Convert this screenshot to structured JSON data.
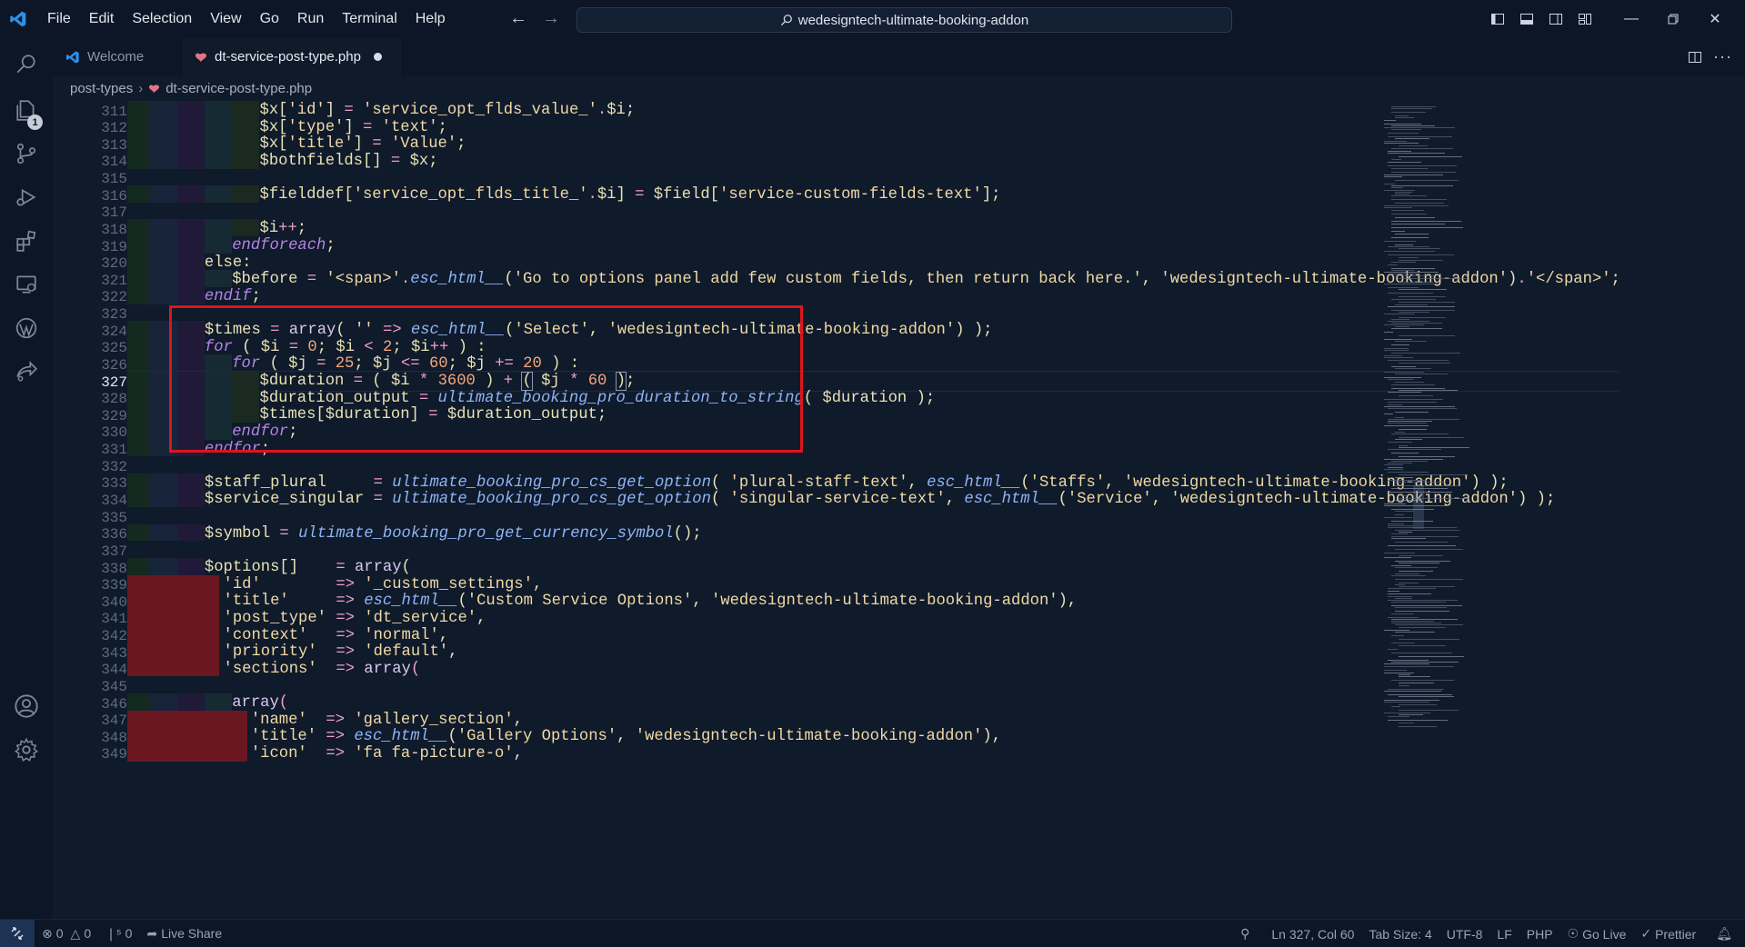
{
  "menu": [
    "File",
    "Edit",
    "Selection",
    "View",
    "Go",
    "Run",
    "Terminal",
    "Help"
  ],
  "search": {
    "text": "wedesigntech-ultimate-booking-addon"
  },
  "activity": {
    "scm_badge": "1"
  },
  "tabs": [
    {
      "label": "Welcome",
      "active": false
    },
    {
      "label": "dt-service-post-type.php",
      "active": true,
      "dirty": true
    }
  ],
  "breadcrumb": {
    "folder": "post-types",
    "file": "dt-service-post-type.php"
  },
  "editor": {
    "first_visible_line": "310",
    "current_line": 327,
    "lines": [
      {
        "n": "311",
        "indent": 5,
        "html": "<span class='v'>$x</span><span class='p'>[</span><span class='s'>'id'</span><span class='p'>] </span><span class='o'>=</span> <span class='s'>'service_opt_flds_value_'</span><span class='o'>.</span><span class='v'>$i</span><span class='p'>;</span>"
      },
      {
        "n": "312",
        "indent": 5,
        "html": "<span class='v'>$x</span><span class='p'>[</span><span class='s'>'type'</span><span class='p'>] </span><span class='o'>=</span> <span class='s'>'text'</span><span class='p'>;</span>"
      },
      {
        "n": "313",
        "indent": 5,
        "html": "<span class='v'>$x</span><span class='p'>[</span><span class='s'>'title'</span><span class='p'>] </span><span class='o'>=</span> <span class='s'>'Value'</span><span class='p'>;</span>"
      },
      {
        "n": "314",
        "indent": 5,
        "html": "<span class='v'>$bothfields</span><span class='p'>[] </span><span class='o'>=</span> <span class='v'>$x</span><span class='p'>;</span>"
      },
      {
        "n": "315",
        "indent": 0,
        "html": ""
      },
      {
        "n": "316",
        "indent": 5,
        "html": "<span class='v'>$fielddef</span><span class='p'>[</span><span class='s'>'service_opt_flds_title_'</span><span class='o'>.</span><span class='v'>$i</span><span class='p'>] </span><span class='o'>=</span> <span class='v'>$field</span><span class='p'>[</span><span class='s'>'service-custom-fields-text'</span><span class='p'>];</span>"
      },
      {
        "n": "317",
        "indent": 0,
        "html": ""
      },
      {
        "n": "318",
        "indent": 5,
        "html": "<span class='v'>$i</span><span class='o'>++</span><span class='p'>;</span>"
      },
      {
        "n": "319",
        "indent": 4,
        "html": "<span class='k'>endforeach</span><span class='p'>;</span>"
      },
      {
        "n": "320",
        "indent": 3,
        "html": "<span class='k' style='font-style:normal;color:#e8e2b4'>else</span><span class='p'>:</span>"
      },
      {
        "n": "321",
        "indent": 4,
        "html": "<span class='v'>$before</span> <span class='o'>=</span> <span class='s'>'&lt;span&gt;'</span><span class='o'>.</span><span class='f'>esc_html__</span><span class='p'>(</span><span class='s'>'Go to options panel add few custom fields, then return back here.'</span><span class='p'>, </span><span class='s'>'wedesigntech-ultimate-booking-addon'</span><span class='p'>)</span><span class='o'>.</span><span class='s'>'&lt;/span&gt;'</span><span class='p'>;</span>"
      },
      {
        "n": "322",
        "indent": 3,
        "html": "<span class='k'>endif</span><span class='p'>;</span>"
      },
      {
        "n": "323",
        "indent": 0,
        "html": ""
      },
      {
        "n": "324",
        "indent": 3,
        "html": "<span class='v'>$times</span> <span class='o'>=</span> <span class='pl'>array</span><span class='p'>( </span><span class='s'>''</span> <span class='o'>=&gt;</span> <span class='f'>esc_html__</span><span class='p'>(</span><span class='s'>'Select'</span><span class='p'>, </span><span class='s'>'wedesigntech-ultimate-booking-addon'</span><span class='p'>) );</span>"
      },
      {
        "n": "325",
        "indent": 3,
        "html": "<span class='k'>for</span><span class='p'> ( </span><span class='v'>$i</span> <span class='o'>=</span> <span class='n'>0</span><span class='p'>; </span><span class='v'>$i</span> <span class='o'>&lt;</span> <span class='n'>2</span><span class='p'>; </span><span class='v'>$i</span><span class='o'>++</span><span class='p'> ) :</span>"
      },
      {
        "n": "326",
        "indent": 4,
        "html": "<span class='k'>for</span><span class='p'> ( </span><span class='v'>$j</span> <span class='o'>=</span> <span class='n'>25</span><span class='p'>; </span><span class='v'>$j</span> <span class='o'>&lt;=</span> <span class='n'>60</span><span class='p'>; </span><span class='v'>$j</span> <span class='o'>+=</span> <span class='n'>20</span><span class='p'> ) :</span>"
      },
      {
        "n": "327",
        "indent": 5,
        "html": "<span class='v'>$duration</span> <span class='o'>=</span><span class='p'> ( </span><span class='v'>$i</span> <span class='o'>*</span> <span class='n'>3600</span><span class='p'> ) </span><span class='o'>+</span> <span class='p' style='outline:1px solid #8c96a8'>(</span><span class='p'> </span><span class='v'>$j</span> <span class='o'>*</span> <span class='n'>60</span> <span class='p' style='outline:1px solid #8c96a8'>)</span><span class='p'>;</span>"
      },
      {
        "n": "328",
        "indent": 5,
        "html": "<span class='v'>$duration_output</span> <span class='o'>=</span> <span class='f'>ultimate_booking_pro_duration_to_string</span><span class='p'>( </span><span class='v'>$duration</span><span class='p'> );</span>"
      },
      {
        "n": "329",
        "indent": 5,
        "html": "<span class='v'>$times</span><span class='p'>[</span><span class='v'>$duration</span><span class='p'>] </span><span class='o'>=</span> <span class='v'>$duration_output</span><span class='p'>;</span>"
      },
      {
        "n": "330",
        "indent": 4,
        "html": "<span class='k'>endfor</span><span class='p'>;</span>"
      },
      {
        "n": "331",
        "indent": 3,
        "html": "<span class='k'>endfor</span><span class='p'>;</span>"
      },
      {
        "n": "332",
        "indent": 0,
        "html": ""
      },
      {
        "n": "333",
        "indent": 3,
        "html": "<span class='v'>$staff_plural</span>     <span class='o'>=</span> <span class='f'>ultimate_booking_pro_cs_get_option</span><span class='p'>( </span><span class='s'>'plural-staff-text'</span><span class='p'>, </span><span class='f'>esc_html__</span><span class='p'>(</span><span class='s'>'Staffs'</span><span class='p'>, </span><span class='s'>'wedesigntech-ultimate-booking-addon'</span><span class='p'>) );</span>"
      },
      {
        "n": "334",
        "indent": 3,
        "html": "<span class='v'>$service_singular</span> <span class='o'>=</span> <span class='f'>ultimate_booking_pro_cs_get_option</span><span class='p'>( </span><span class='s'>'singular-service-text'</span><span class='p'>, </span><span class='f'>esc_html__</span><span class='p'>(</span><span class='s'>'Service'</span><span class='p'>, </span><span class='s'>'wedesigntech-ultimate-booking-addon'</span><span class='p'>) );</span>"
      },
      {
        "n": "335",
        "indent": 0,
        "html": ""
      },
      {
        "n": "336",
        "indent": 3,
        "html": "<span class='v'>$symbol</span> <span class='o'>=</span> <span class='f'>ultimate_booking_pro_get_currency_symbol</span><span class='p'>();</span>"
      },
      {
        "n": "337",
        "indent": 0,
        "html": ""
      },
      {
        "n": "338",
        "indent": 3,
        "html": "<span class='v'>$options</span><span class='p'>[]</span>    <span class='o'>=</span> <span class='pl'>array</span><span class='p'>(</span>"
      },
      {
        "n": "339",
        "indent": 3,
        "err": true,
        "html": "  <span class='s'>'id'</span>        <span class='o'>=&gt;</span> <span class='s'>'_custom_settings'</span><span class='p'>,</span>"
      },
      {
        "n": "340",
        "indent": 3,
        "err": true,
        "html": "  <span class='s'>'title'</span>     <span class='o'>=&gt;</span> <span class='f'>esc_html__</span><span class='p'>(</span><span class='s'>'Custom Service Options'</span><span class='p'>, </span><span class='s'>'wedesigntech-ultimate-booking-addon'</span><span class='p'>),</span>"
      },
      {
        "n": "341",
        "indent": 3,
        "err": true,
        "html": "  <span class='s'>'post_type'</span> <span class='o'>=&gt;</span> <span class='s'>'dt_service'</span><span class='p'>,</span>"
      },
      {
        "n": "342",
        "indent": 3,
        "err": true,
        "html": "  <span class='s'>'context'</span>   <span class='o'>=&gt;</span> <span class='s'>'normal'</span><span class='p'>,</span>"
      },
      {
        "n": "343",
        "indent": 3,
        "err": true,
        "html": "  <span class='s'>'priority'</span>  <span class='o'>=&gt;</span> <span class='s'>'default'</span><span class='p'>,</span>"
      },
      {
        "n": "344",
        "indent": 3,
        "err": true,
        "html": "  <span class='s'>'sections'</span>  <span class='o'>=&gt;</span> <span class='pl'>array</span><span class='o'>(</span>"
      },
      {
        "n": "345",
        "indent": 0,
        "html": ""
      },
      {
        "n": "346",
        "indent": 4,
        "html": "<span class='pl'>array</span><span class='o'>(</span>"
      },
      {
        "n": "347",
        "indent": 4,
        "err": true,
        "errwide": true,
        "html": "  <span class='s'>'name'</span>  <span class='o'>=&gt;</span> <span class='s'>'gallery_section'</span><span class='p'>,</span>"
      },
      {
        "n": "348",
        "indent": 4,
        "err": true,
        "errwide": true,
        "html": "  <span class='s'>'title'</span> <span class='o'>=&gt;</span> <span class='f'>esc_html__</span><span class='p'>(</span><span class='s'>'Gallery Options'</span><span class='p'>, </span><span class='s'>'wedesigntech-ultimate-booking-addon'</span><span class='p'>),</span>"
      },
      {
        "n": "349",
        "indent": 4,
        "err": true,
        "errwide": true,
        "html": "  <span class='s'>'icon'</span>  <span class='o'>=&gt;</span> <span class='s'>'fa fa-picture-o'</span><span class='p'>,</span>"
      }
    ]
  },
  "statusbar": {
    "errors": "0",
    "warnings": "0",
    "ports": "0",
    "live_share": "Live Share",
    "position": "Ln 327, Col 60",
    "tab_size": "Tab Size: 4",
    "encoding": "UTF-8",
    "eol": "LF",
    "language": "PHP",
    "go_live": "Go Live",
    "prettier": "Prettier"
  },
  "colors": {
    "accent": "#1d3354",
    "annotation": "#e0131c",
    "background": "#0f1a2b"
  }
}
